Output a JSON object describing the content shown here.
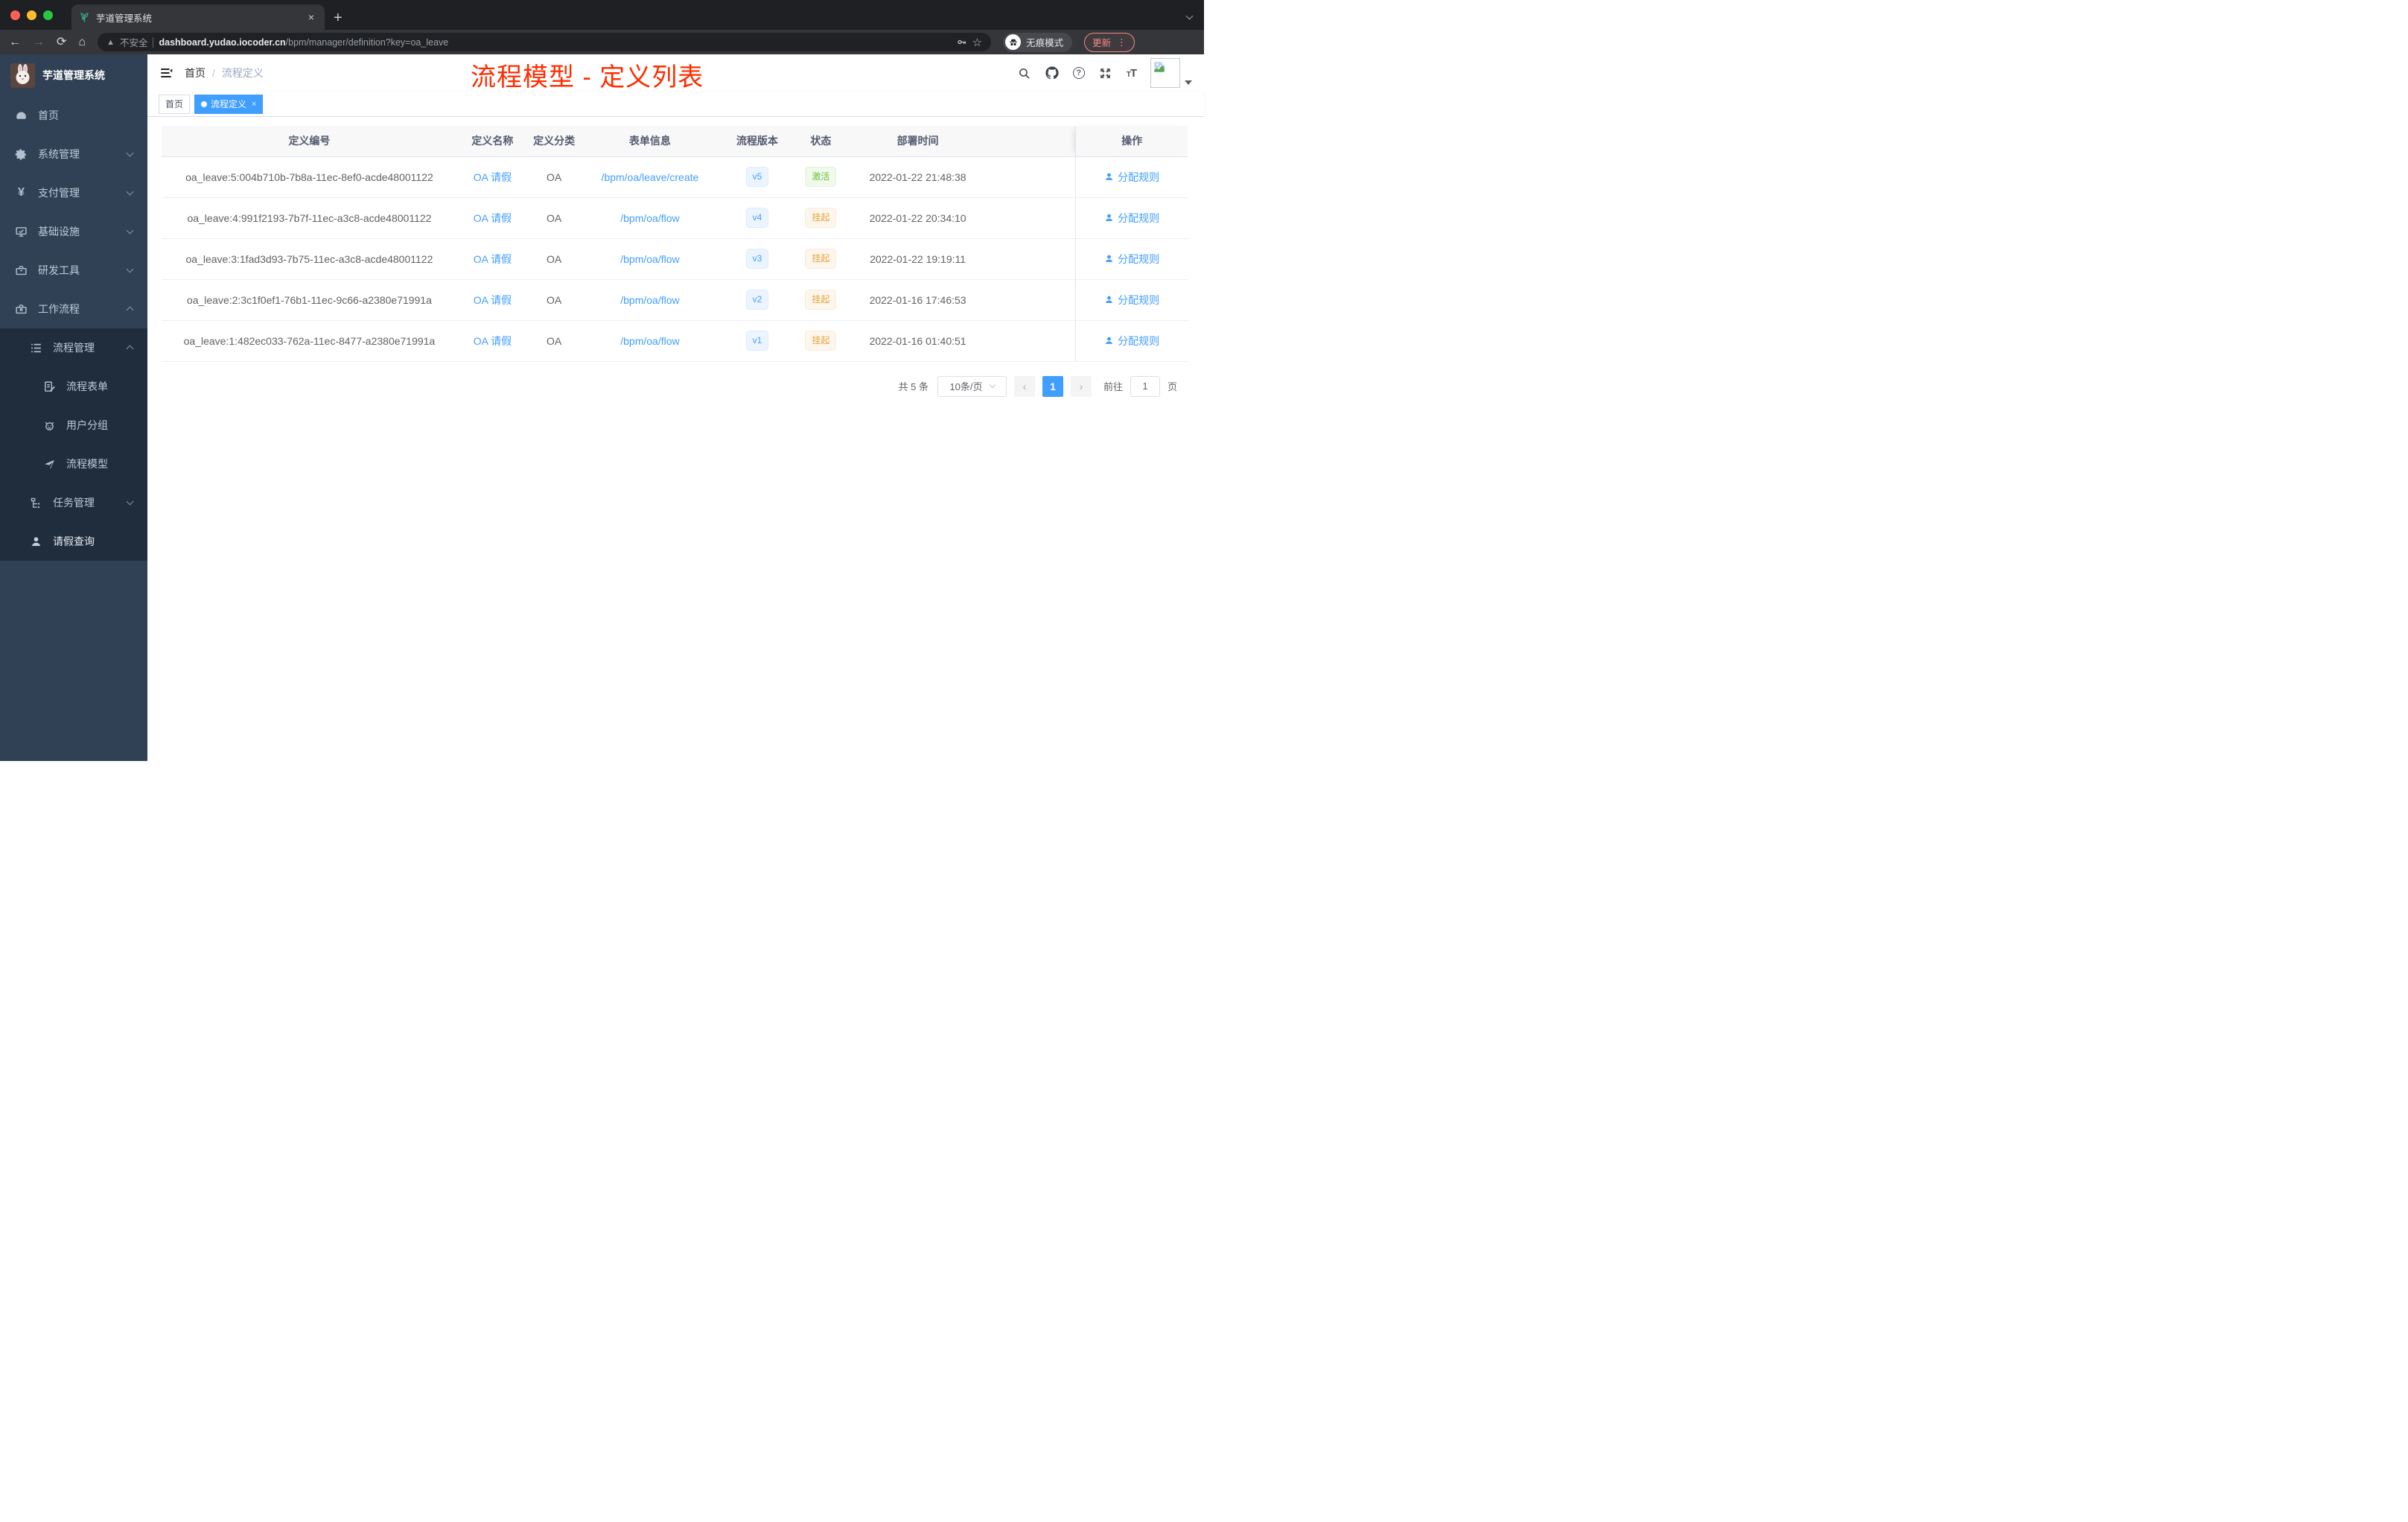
{
  "browser": {
    "tab": {
      "title": "芋道管理系统",
      "close": "×",
      "new_tab": "+"
    },
    "toolbar": {
      "back": "←",
      "forward": "→",
      "reload": "⟳",
      "home": "⌂",
      "security_label": "不安全",
      "url_domain": "dashboard.yudao.iocoder.cn",
      "url_path": "/bpm/manager/definition?key=oa_leave",
      "incognito_label": "无痕模式",
      "update_label": "更新",
      "menu_dots": "⋮",
      "star": "☆"
    }
  },
  "sidebar": {
    "logo_title": "芋道管理系统",
    "menu": [
      {
        "label": "首页"
      },
      {
        "label": "系统管理"
      },
      {
        "label": "支付管理"
      },
      {
        "label": "基础设施"
      },
      {
        "label": "研发工具"
      },
      {
        "label": "工作流程"
      },
      {
        "label": "流程管理"
      },
      {
        "label": "流程表单"
      },
      {
        "label": "用户分组"
      },
      {
        "label": "流程模型"
      },
      {
        "label": "任务管理"
      },
      {
        "label": "请假查询"
      }
    ]
  },
  "header": {
    "breadcrumb_home": "首页",
    "breadcrumb_sep": "/",
    "breadcrumb_current": "流程定义",
    "font_size_icon": "tT",
    "annotation": "流程模型 - 定义列表"
  },
  "tags": {
    "home": "首页",
    "active": "流程定义",
    "close": "×"
  },
  "table": {
    "columns": [
      "定义编号",
      "定义名称",
      "定义分类",
      "表单信息",
      "流程版本",
      "状态",
      "部署时间",
      "操作"
    ],
    "rows": [
      {
        "id": "oa_leave:5:004b710b-7b8a-11ec-8ef0-acde48001122",
        "name": "OA 请假",
        "category": "OA",
        "form": "/bpm/oa/leave/create",
        "version": "v5",
        "status": "激活",
        "time": "2022-01-22 21:48:38",
        "action": "分配规则"
      },
      {
        "id": "oa_leave:4:991f2193-7b7f-11ec-a3c8-acde48001122",
        "name": "OA 请假",
        "category": "OA",
        "form": "/bpm/oa/flow",
        "version": "v4",
        "status": "挂起",
        "time": "2022-01-22 20:34:10",
        "action": "分配规则"
      },
      {
        "id": "oa_leave:3:1fad3d93-7b75-11ec-a3c8-acde48001122",
        "name": "OA 请假",
        "category": "OA",
        "form": "/bpm/oa/flow",
        "version": "v3",
        "status": "挂起",
        "time": "2022-01-22 19:19:11",
        "action": "分配规则"
      },
      {
        "id": "oa_leave:2:3c1f0ef1-76b1-11ec-9c66-a2380e71991a",
        "name": "OA 请假",
        "category": "OA",
        "form": "/bpm/oa/flow",
        "version": "v2",
        "status": "挂起",
        "time": "2022-01-16 17:46:53",
        "action": "分配规则"
      },
      {
        "id": "oa_leave:1:482ec033-762a-11ec-8477-a2380e71991a",
        "name": "OA 请假",
        "category": "OA",
        "form": "/bpm/oa/flow",
        "version": "v1",
        "status": "挂起",
        "time": "2022-01-16 01:40:51",
        "action": "分配规则"
      }
    ]
  },
  "pagination": {
    "total": "共 5 条",
    "page_size": "10条/页",
    "prev": "‹",
    "page": "1",
    "next": "›",
    "goto": "前往",
    "goto_value": "1",
    "unit": "页"
  },
  "colors": {
    "primary": "#409eff",
    "success": "#67c23a",
    "warning": "#e6a23c",
    "annotation_red": "#ff2c00",
    "sidebar_bg": "#304156",
    "submenu_bg": "#1f2d3d"
  }
}
